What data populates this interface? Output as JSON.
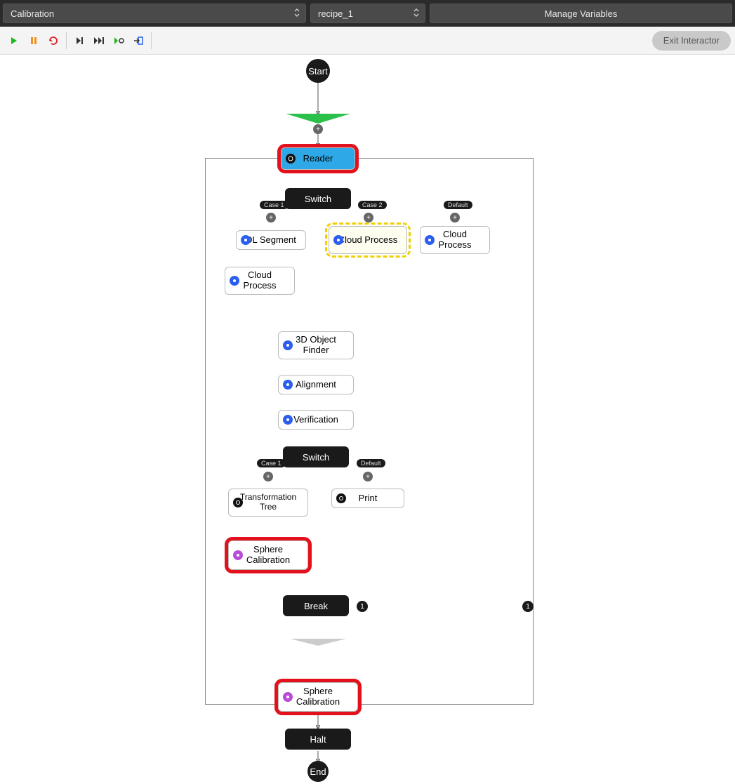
{
  "header": {
    "dropdown1": "Calibration",
    "dropdown2": "recipe_1",
    "manage_btn": "Manage Variables"
  },
  "toolbar": {
    "exit_label": "Exit Interactor"
  },
  "flow": {
    "start": "Start",
    "end": "End",
    "reader": "Reader",
    "switch1": "Switch",
    "case1": "Case 1",
    "case2": "Case 2",
    "default": "Default",
    "dlsegment": "DL Segment",
    "cloudprocess": "Cloud Process",
    "objfinder": "3D Object Finder",
    "alignment": "Alignment",
    "verification": "Verification",
    "switch2": "Switch",
    "case1b": "Case 1",
    "defaultb": "Default",
    "transformtree": "Transformation Tree",
    "print": "Print",
    "spherecal": "Sphere Calibration",
    "break": "Break",
    "halt": "Halt",
    "badge1": "1"
  },
  "colors": {
    "highlight": "#e2111c",
    "selection": "#2ea8e6",
    "accent_green": "#2bc04a",
    "icon_blue": "#2b5ef0",
    "icon_purple": "#b84bd8"
  }
}
